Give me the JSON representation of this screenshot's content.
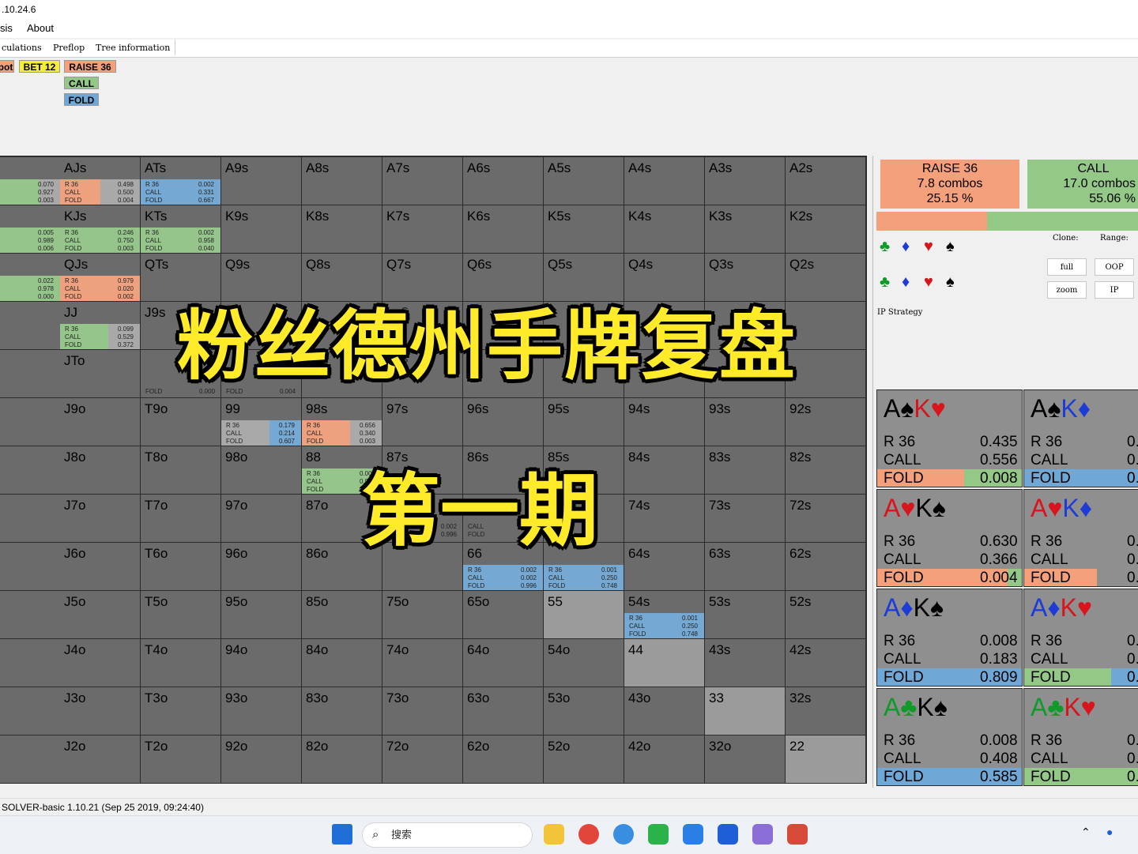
{
  "window": {
    "title": ".10.24.6"
  },
  "menu": [
    "sis",
    "About"
  ],
  "tabs": [
    "culations",
    "Preflop",
    "Tree information"
  ],
  "actions_top": {
    "pot": "pot",
    "bet": "BET 12",
    "raise": "RAISE 36",
    "call": "CALL",
    "fold": "FOLD"
  },
  "grid": {
    "rows": [
      [
        "Qs",
        "AJs",
        "ATs",
        "A9s",
        "A8s",
        "A7s",
        "A6s",
        "A5s",
        "A4s",
        "A3s",
        "A2s"
      ],
      [
        "Qs",
        "KJs",
        "KTs",
        "K9s",
        "K8s",
        "K7s",
        "K6s",
        "K5s",
        "K4s",
        "K3s",
        "K2s"
      ],
      [
        "Q",
        "QJs",
        "QTs",
        "Q9s",
        "Q8s",
        "Q7s",
        "Q6s",
        "Q5s",
        "Q4s",
        "Q3s",
        "Q2s"
      ],
      [
        "o",
        "JJ",
        "J9s",
        "",
        "",
        "",
        "",
        "",
        "",
        "",
        ""
      ],
      [
        "To",
        "JTo",
        "",
        "",
        "",
        "",
        "",
        "",
        "",
        "",
        ""
      ],
      [
        "9o",
        "J9o",
        "T9o",
        "99",
        "98s",
        "97s",
        "96s",
        "95s",
        "94s",
        "93s",
        "92s"
      ],
      [
        "8o",
        "J8o",
        "T8o",
        "98o",
        "88",
        "87s",
        "86s",
        "85s",
        "84s",
        "83s",
        "82s"
      ],
      [
        "7o",
        "J7o",
        "T7o",
        "97o",
        "87o",
        "",
        "",
        "",
        "74s",
        "73s",
        "72s"
      ],
      [
        "6o",
        "J6o",
        "T6o",
        "96o",
        "86o",
        "",
        "66",
        "",
        "64s",
        "63s",
        "62s"
      ],
      [
        "5o",
        "J5o",
        "T5o",
        "95o",
        "85o",
        "75o",
        "65o",
        "55",
        "54s",
        "53s",
        "52s"
      ],
      [
        "4o",
        "J4o",
        "T4o",
        "94o",
        "84o",
        "74o",
        "64o",
        "54o",
        "44",
        "43s",
        "42s"
      ],
      [
        "3o",
        "J3o",
        "T3o",
        "93o",
        "83o",
        "73o",
        "63o",
        "53o",
        "43o",
        "33",
        "32s"
      ],
      [
        "2o",
        "J2o",
        "T2o",
        "92o",
        "82o",
        "72o",
        "62o",
        "52o",
        "42o",
        "32o",
        "22"
      ]
    ],
    "strategies": [
      {
        "cell": "0-0",
        "labels": [
          "",
          "",
          ""
        ],
        "values": [
          "0.070",
          "0.927",
          "0.003"
        ]
      },
      {
        "cell": "0-1",
        "labels": [
          "R 36",
          "CALL",
          "FOLD"
        ],
        "values": [
          "0.498",
          "0.500",
          "0.004"
        ]
      },
      {
        "cell": "0-2",
        "labels": [
          "R 36",
          "CALL",
          "FOLD"
        ],
        "values": [
          "0.002",
          "0.331",
          "0.667"
        ]
      },
      {
        "cell": "1-0",
        "labels": [
          "",
          "",
          ""
        ],
        "values": [
          "0.005",
          "0.989",
          "0.006"
        ]
      },
      {
        "cell": "1-1",
        "labels": [
          "R 36",
          "CALL",
          "FOLD"
        ],
        "values": [
          "0.246",
          "0.750",
          "0.003"
        ]
      },
      {
        "cell": "1-2",
        "labels": [
          "R 36",
          "CALL",
          "FOLD"
        ],
        "values": [
          "0.002",
          "0.958",
          "0.040"
        ]
      },
      {
        "cell": "2-0",
        "labels": [
          "",
          "",
          ""
        ],
        "values": [
          "0.022",
          "0.978",
          "0.000"
        ]
      },
      {
        "cell": "2-1",
        "labels": [
          "R 36",
          "CALL",
          "FOLD"
        ],
        "values": [
          "0.979",
          "0.020",
          "0.002"
        ]
      },
      {
        "cell": "3-1",
        "labels": [
          "R 36",
          "CALL",
          "FOLD"
        ],
        "values": [
          "0.099",
          "0.529",
          "0.372"
        ]
      },
      {
        "cell": "5-3",
        "labels": [
          "R 36",
          "CALL",
          "FOLD"
        ],
        "values": [
          "0.179",
          "0.214",
          "0.607"
        ]
      },
      {
        "cell": "5-4",
        "labels": [
          "R 36",
          "CALL",
          "FOLD"
        ],
        "values": [
          "0.656",
          "0.340",
          "0.003"
        ]
      },
      {
        "cell": "6-4",
        "labels": [
          "R 36",
          "CALL",
          "FOLD"
        ],
        "values": [
          "0.003",
          "0.987",
          "0.010"
        ]
      },
      {
        "cell": "8-6",
        "labels": [
          "R 36",
          "CALL",
          "FOLD"
        ],
        "values": [
          "0.002",
          "0.002",
          "0.996"
        ]
      },
      {
        "cell": "8-7",
        "labels": [
          "R 36",
          "CALL",
          "FOLD"
        ],
        "values": [
          "0.001",
          "0.250",
          "0.748"
        ]
      },
      {
        "cell": "9-8",
        "labels": [
          "R 36",
          "CALL",
          "FOLD"
        ],
        "values": [
          "0.001",
          "0.250",
          "0.748"
        ]
      }
    ],
    "partial_texts": {
      "t4_fold": "FOLD",
      "t4_fold_v": "0.000",
      "t4_fold2": "FOLD",
      "t4_fold2_v": "0.004",
      "c7_v1": "0.002",
      "c7_v2": "0.996",
      "c7_call": "CALL",
      "c7_fold": "FOLD",
      "j9": "J9",
      "s1": "s",
      "s2": "s"
    }
  },
  "overlay": {
    "title": "粉丝德州手牌复盘",
    "subtitle": "第一期"
  },
  "summary": {
    "raise": {
      "label": "RAISE 36",
      "combos": "7.8 combos",
      "pct": "25.15 %"
    },
    "call": {
      "label": "CALL",
      "combos": "17.0 combos",
      "pct": "55.06 %"
    }
  },
  "controls": {
    "clone": "Clone:",
    "range": "Range:",
    "full": "full",
    "oop": "OOP",
    "zoom": "zoom",
    "ip": "IP",
    "ip_strategy": "IP Strategy"
  },
  "combos": [
    {
      "card1": "A",
      "s1": "♠",
      "c1": "#000",
      "card2": "K",
      "s2": "♥",
      "c2": "#d8141c",
      "r": "0.435",
      "c": "0.556",
      "f": "0.008"
    },
    {
      "card1": "A",
      "s1": "♠",
      "c1": "#000",
      "card2": "K",
      "s2": "♦",
      "c2": "#1e3bd6",
      "r": "0.",
      "c": "0.",
      "f": "0."
    },
    {
      "card1": "A",
      "s1": "♥",
      "c1": "#d8141c",
      "card2": "K",
      "s2": "♠",
      "c2": "#000",
      "r": "0.630",
      "c": "0.366",
      "f": "0.004"
    },
    {
      "card1": "A",
      "s1": "♥",
      "c1": "#d8141c",
      "card2": "K",
      "s2": "♦",
      "c2": "#1e3bd6",
      "r": "0.",
      "c": "0.",
      "f": "0."
    },
    {
      "card1": "A",
      "s1": "♦",
      "c1": "#1e3bd6",
      "card2": "K",
      "s2": "♠",
      "c2": "#000",
      "r": "0.008",
      "c": "0.183",
      "f": "0.809"
    },
    {
      "card1": "A",
      "s1": "♦",
      "c1": "#1e3bd6",
      "card2": "K",
      "s2": "♥",
      "c2": "#d8141c",
      "r": "0.",
      "c": "0.",
      "f": "0."
    },
    {
      "card1": "A",
      "s1": "♣",
      "c1": "#0f9a2a",
      "card2": "K",
      "s2": "♠",
      "c2": "#000",
      "r": "0.008",
      "c": "0.408",
      "f": "0.585"
    },
    {
      "card1": "A",
      "s1": "♣",
      "c1": "#0f9a2a",
      "card2": "K",
      "s2": "♥",
      "c2": "#d8141c",
      "r": "0.",
      "c": "0.",
      "f": "0."
    }
  ],
  "combo_labels": {
    "r": "R 36",
    "c": "CALL",
    "f": "FOLD"
  },
  "status": "SOLVER-basic 1.10.21 (Sep 25 2019, 09:24:40)",
  "taskbar": {
    "search_placeholder": "搜索"
  },
  "colors": {
    "raise": "#f4a07a",
    "call": "#93c887",
    "fold": "#6fa7d6",
    "bet": "#f5ec3c"
  }
}
